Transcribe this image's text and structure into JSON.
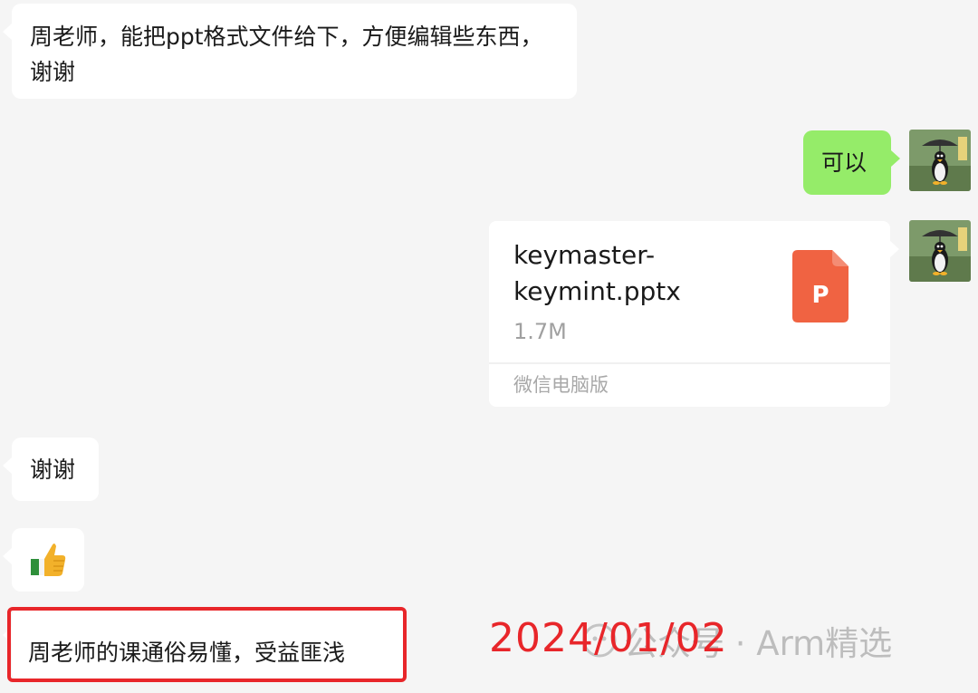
{
  "messages": [
    {
      "side": "left",
      "text": "周老师，能把ppt格式文件给下，方便编辑些东西，谢谢"
    },
    {
      "side": "right",
      "text": "可以"
    },
    {
      "side": "left",
      "text": "谢谢"
    },
    {
      "side": "left",
      "emoji": "thumbs-up-icon"
    },
    {
      "side": "left",
      "text": "周老师的课通俗易懂，受益匪浅"
    }
  ],
  "file_card": {
    "name_line1": "keymaster-",
    "name_line2": "keymint.pptx",
    "size": "1.7M",
    "source": "微信电脑版",
    "icon": "ppt-file-icon",
    "icon_letter": "P"
  },
  "overlay": {
    "date": "2024/01/02",
    "watermark": "公众号 · Arm精选"
  },
  "colors": {
    "background": "#f5f5f5",
    "left_bubble": "#ffffff",
    "right_bubble": "#95ec69",
    "highlight": "#e8262a",
    "ppt_icon": "#f06342"
  }
}
